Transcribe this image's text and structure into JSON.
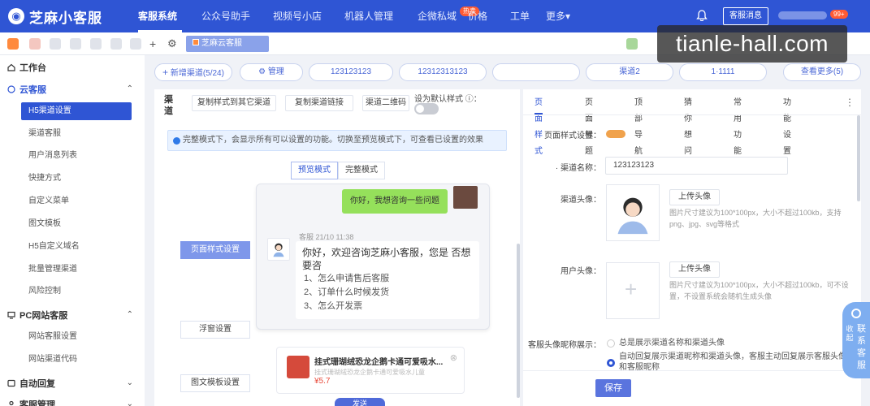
{
  "topbar": {
    "logo_text": "芝麻小客服",
    "nav": [
      "客服系统",
      "公众号助手",
      "视频号小店",
      "机器人管理",
      "企微私域",
      "价格",
      "工单",
      "更多▾"
    ],
    "hot_badge": "热卖",
    "message_button": "客服消息",
    "user_badge": "99+"
  },
  "toolbar": {
    "active_tab": "芝麻云客服"
  },
  "watermark": "tianle-hall.com",
  "sidebar": {
    "workbench": "工作台",
    "cloud_service": "云客服",
    "cloud_items": [
      "H5渠道设置",
      "渠道客服",
      "用户消息列表",
      "快捷方式",
      "自定义菜单",
      "图文模板",
      "H5自定义域名",
      "批量管理渠道",
      "风险控制"
    ],
    "pc_service": "PC网站客服",
    "pc_items": [
      "网站客服设置",
      "网站渠道代码"
    ],
    "auto_reply": "自动回复",
    "service_mgmt": "客服管理"
  },
  "channels": {
    "add": "新增渠道(5/24)",
    "manage": "管理",
    "tabs": [
      "123123123",
      "12312313123",
      "",
      "渠道2",
      "1·1111"
    ],
    "more": "查看更多(5)"
  },
  "middle": {
    "vertical_label": "渠道",
    "buttons": [
      "复制样式到其它渠道",
      "复制渠道链接",
      "渠道二维码"
    ],
    "default_style_label": "设为默认样式 ⓘ：",
    "info": "完整模式下，会显示所有可以设置的功能。切换至预览模式下，可查看已设置的效果",
    "mode_preview": "预览模式",
    "mode_full": "完整模式",
    "side_buttons": [
      "页面样式设置",
      "浮窗设置",
      "图文模板设置"
    ],
    "user_question": "你好，我想咨询一些问题",
    "meta": "客服 21/10 11:38",
    "greeting": "你好，欢迎咨询芝麻小客服，您是 否想要咨",
    "options": [
      "1、怎么申请售后客服",
      "2、订单什么时候发货",
      "3、怎么开发票"
    ],
    "product_title": "挂式珊瑚绒恐龙企鹅卡通可爱吸水...",
    "product_sub": "挂式珊瑚绒恐龙企鹅卡通可爱吸水儿童",
    "product_price": "¥5.7",
    "product_close": "⊗",
    "send": "发送"
  },
  "right": {
    "tabs": [
      "页面样式",
      "页面标题",
      "顶部导航",
      "猜你想问",
      "常用功能",
      "功能设置"
    ],
    "more": "⋮",
    "page_style_label": "页面样式设置：",
    "channel_name_label": "· 渠道名称：",
    "channel_name_value": "123123123",
    "channel_avatar_label": "渠道头像：",
    "upload": "上传头像",
    "avatar_hint": "图片尺寸建议为100*100px，大小不超过100kb，支持png、jpg、svg等格式",
    "user_avatar_label": "用户头像：",
    "user_hint": "图片尺寸建议为100*100px，大小不超过100kb，可不设置，不设置系统会随机生成头像",
    "display_label": "客服头像昵称展示：",
    "option1": "总是展示渠道名称和渠道头像",
    "option2": "自动回复展示渠道昵称和渠道头像，客服主动回复展示客服头像和客服昵称",
    "save": "保存"
  },
  "float": {
    "collapse": "收起",
    "contact": "联系客服"
  },
  "colors": {
    "brand": "#2f55d4",
    "accent": "#ff5b34",
    "bubble": "#95e05b"
  }
}
